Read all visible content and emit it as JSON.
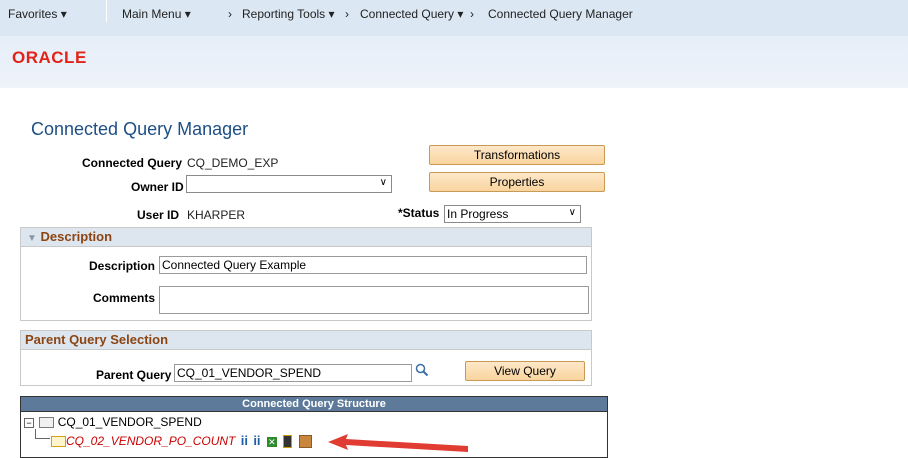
{
  "nav": {
    "favorites": "Favorites",
    "main_menu": "Main Menu",
    "reporting_tools": "Reporting Tools",
    "connected_query": "Connected Query",
    "connected_query_manager": "Connected Query Manager"
  },
  "logo": {
    "text": "ORACLE"
  },
  "page": {
    "title": "Connected Query Manager"
  },
  "form": {
    "connected_query_label": "Connected Query",
    "connected_query_value": "CQ_DEMO_EXP",
    "owner_id_label": "Owner ID",
    "owner_id_value": "",
    "user_id_label": "User ID",
    "user_id_value": "KHARPER",
    "status_label": "*Status",
    "status_value": "In Progress",
    "transformations_button": "Transformations",
    "properties_button": "Properties"
  },
  "description_section": {
    "title": "Description",
    "description_label": "Description",
    "description_value": "Connected Query Example",
    "comments_label": "Comments",
    "comments_value": ""
  },
  "parent_section": {
    "title": "Parent Query Selection",
    "parent_query_label": "Parent Query",
    "parent_query_value": "CQ_01_VENDOR_SPEND",
    "view_query_button": "View Query"
  },
  "structure": {
    "title": "Connected Query Structure",
    "root": "CQ_01_VENDOR_SPEND",
    "child": "CQ_02_VENDOR_PO_COUNT"
  },
  "colors": {
    "accent": "#1d4f84",
    "child_query": "#cc0000",
    "arrow": "#e03c31"
  }
}
